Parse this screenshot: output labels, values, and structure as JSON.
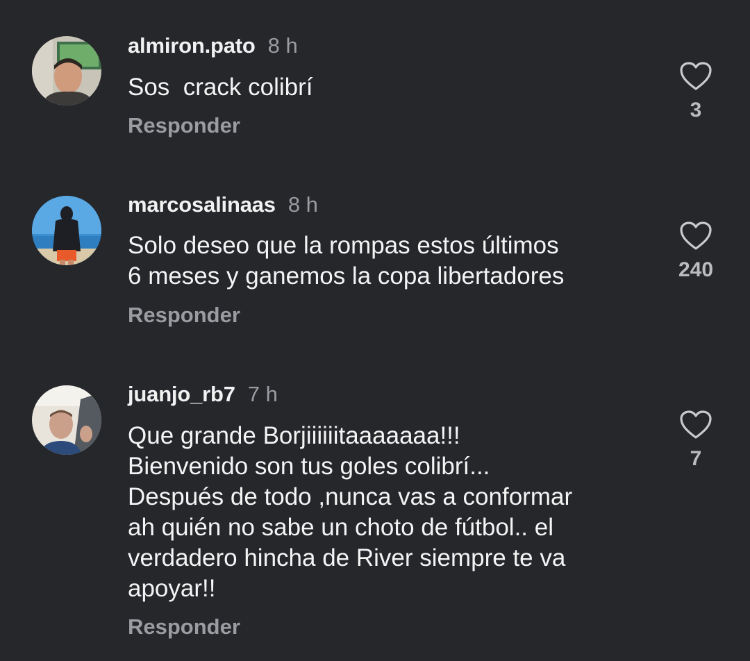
{
  "comments": [
    {
      "username": "almiron.pato",
      "time": "8 h",
      "text": "Sos  crack colibrí",
      "reply_label": "Responder",
      "likes": "3",
      "avatar": "avatar-man-tv"
    },
    {
      "username": "marcosalinaas",
      "time": "8 h",
      "text": "Solo deseo que la rompas estos últimos\n6 meses y ganemos la copa libertadores",
      "reply_label": "Responder",
      "likes": "240",
      "avatar": "avatar-man-beach"
    },
    {
      "username": "juanjo_rb7",
      "time": "7 h",
      "text": "Que grande Borjiiiiiitaaaaaaa!!!\nBienvenido son tus goles colibrí...\nDespués de todo ,nunca vas a conformar\nah quién no sabe un choto de fútbol.. el\nverdadero hincha de River siempre te va\napoyar!!",
      "reply_label": "Responder",
      "likes": "7",
      "avatar": "avatar-man-car"
    }
  ],
  "colors": {
    "background": "#25272b",
    "primary_text": "#f2f2f2",
    "secondary_text": "#9a9ca1"
  }
}
